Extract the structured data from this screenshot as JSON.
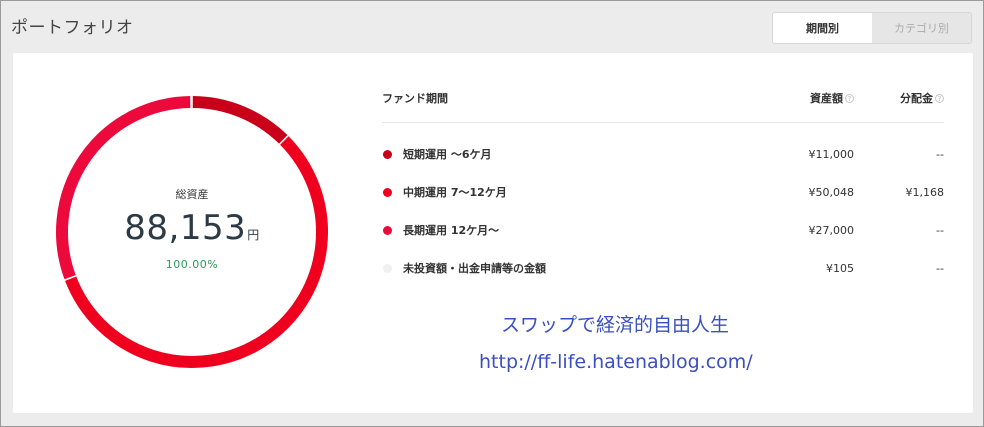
{
  "section_title": "ポートフォリオ",
  "tabs": [
    {
      "label": "期間別",
      "active": true
    },
    {
      "label": "カテゴリ別",
      "active": false
    }
  ],
  "summary": {
    "label": "総資産",
    "amount": "88,153",
    "unit": "円",
    "percent": "100.00%"
  },
  "table": {
    "headers": {
      "name": "ファンド期間",
      "amount": "資産額",
      "dividend": "分配金",
      "help_icon": "?"
    },
    "rows": [
      {
        "name": "短期運用 〜6ケ月",
        "amount": "¥11,000",
        "dividend": "--",
        "color": "#c8001a",
        "value": 11000
      },
      {
        "name": "中期運用 7〜12ケ月",
        "amount": "¥50,048",
        "dividend": "¥1,168",
        "color": "#f0001f",
        "value": 50048
      },
      {
        "name": "長期運用 12ケ月〜",
        "amount": "¥27,000",
        "dividend": "--",
        "color": "#ec0a3c",
        "value": 27000
      },
      {
        "name": "未投資額・出金申請等の金額",
        "amount": "¥105",
        "dividend": "--",
        "color": "#f0f0f0",
        "value": 105
      }
    ]
  },
  "watermark": {
    "line1": "スワップで経済的自由人生",
    "line2": "http://ff-life.hatenablog.com/"
  }
}
